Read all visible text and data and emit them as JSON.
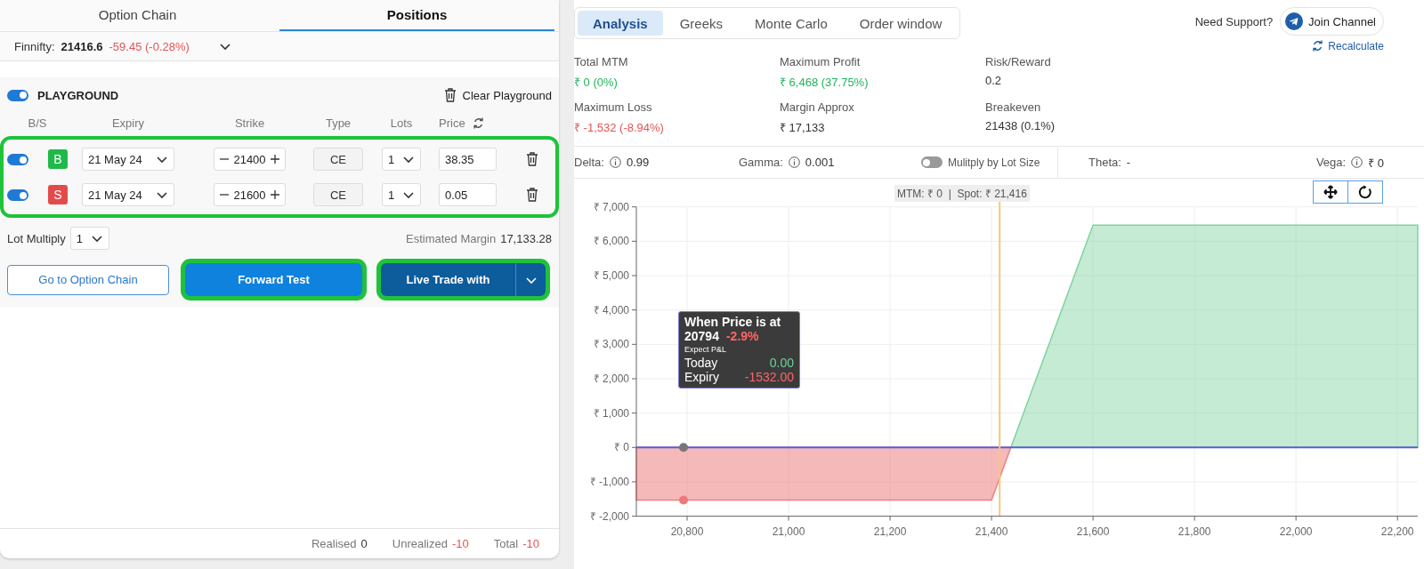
{
  "left_panel": {
    "tabs": [
      {
        "label": "Option Chain",
        "selected": false
      },
      {
        "label": "Positions",
        "selected": true
      }
    ],
    "index": {
      "name": "Finnifty:",
      "price": "21416.6",
      "change": "-59.45 (-0.28%)",
      "color": "#e25555"
    },
    "playground": {
      "on": true,
      "label": "PLAYGROUND",
      "clear_button": "Clear Playground"
    },
    "leg_columns": [
      "B/S",
      "Expiry",
      "Strike",
      "Type",
      "Lots",
      "Price"
    ],
    "legs_highlighted": true,
    "legs": [
      {
        "enabled": true,
        "side": "B",
        "kind": "buy",
        "expiry": "21 May 24",
        "strike": "21400",
        "type": "CE",
        "lots": "1",
        "price": "38.35"
      },
      {
        "enabled": true,
        "side": "S",
        "kind": "sell",
        "expiry": "21 May 24",
        "strike": "21600",
        "type": "CE",
        "lots": "1",
        "price": "0.05"
      }
    ],
    "lot_multiply": {
      "label": "Lot Multiply",
      "value": "1"
    },
    "estimated_margin": {
      "label": "Estimated Margin",
      "value": "17,133.28"
    },
    "buttons": [
      {
        "label": "Go to Option Chain",
        "kind": "outline",
        "highlighted": false
      },
      {
        "label": "Forward Test",
        "kind": "primary",
        "highlighted": true
      },
      {
        "label": "Live Trade with",
        "kind": "split",
        "highlighted": true
      }
    ],
    "footer": [
      {
        "label": "Realised",
        "value": "0",
        "color": "#333333"
      },
      {
        "label": "Unrealized",
        "value": "-10",
        "color": "#e25555"
      },
      {
        "label": "Total",
        "value": "-10",
        "color": "#e25555"
      }
    ]
  },
  "right_panel": {
    "tabs": [
      {
        "label": "Analysis",
        "selected": true
      },
      {
        "label": "Greeks",
        "selected": false
      },
      {
        "label": "Monte Carlo",
        "selected": false
      },
      {
        "label": "Order window",
        "selected": false
      }
    ],
    "support": {
      "label": "Need Support?",
      "button": "Join Channel"
    },
    "recalculate": "Recalculate",
    "stats": [
      {
        "label": "Total MTM",
        "value": "₹ 0 (0%)",
        "color": "#22b35e"
      },
      {
        "label": "Maximum Profit",
        "value": "₹ 6,468 (37.75%)",
        "color": "#22b35e"
      },
      {
        "label": "Risk/Reward",
        "value": "0.2",
        "color": "#333333"
      },
      {
        "label": "Maximum Loss",
        "value": "₹ -1,532 (-8.94%)",
        "color": "#e25555"
      },
      {
        "label": "Margin Approx",
        "value": "₹ 17,133",
        "color": "#333333"
      },
      {
        "label": "Breakeven",
        "value": "21438 (0.1%)",
        "color": "#333333"
      }
    ],
    "greeks": [
      {
        "kind": "metric",
        "label": "Delta:",
        "info": true,
        "value": "0.99"
      },
      {
        "kind": "metric",
        "label": "Gamma:",
        "info": true,
        "value": "0.001"
      },
      {
        "kind": "toggle",
        "label": "Mulitply by Lot Size",
        "on": false
      },
      {
        "kind": "metric",
        "label": "Theta:",
        "info": false,
        "value": "-"
      },
      {
        "kind": "metric",
        "label": "Vega:",
        "info": true,
        "value": "₹ 0"
      }
    ],
    "chart": {
      "header": "MTM: ₹ 0  |  Spot: ₹ 21,416",
      "tooltip": {
        "title": "When Price is at",
        "price": "20794",
        "change": "-2.9%",
        "subtitle": "Expect P&L",
        "rows": [
          {
            "label": "Today",
            "value": "0.00",
            "color": "#6fd39a"
          },
          {
            "label": "Expiry",
            "value": "-1532.00",
            "color": "#ff6565"
          }
        ]
      },
      "chart_data": {
        "type": "area",
        "x": [
          20700,
          21400,
          21438,
          21600,
          22240
        ],
        "series": [
          {
            "color": "#ee8080",
            "values": [
              -1532,
              -1532,
              0,
              null,
              null
            ]
          },
          {
            "color": "#7fd3a0",
            "values": [
              null,
              null,
              0,
              6468,
              6468
            ]
          }
        ],
        "xlim": [
          20700,
          22240
        ],
        "ylim": [
          -2000,
          7000
        ],
        "grid": true,
        "ref_lines": [
          {
            "axis": "y",
            "value": 0,
            "color": "#5a5fd6"
          },
          {
            "axis": "x",
            "value": 21416,
            "color": "#f5c77e"
          }
        ],
        "xticks": [
          {
            "value": 20800,
            "label": "20,800"
          },
          {
            "value": 21000,
            "label": "21,000"
          },
          {
            "value": 21200,
            "label": "21,200"
          },
          {
            "value": 21400,
            "label": "21,400"
          },
          {
            "value": 21600,
            "label": "21,600"
          },
          {
            "value": 21800,
            "label": "21,800"
          },
          {
            "value": 22000,
            "label": "22,000"
          },
          {
            "value": 22200,
            "label": "22,200"
          }
        ],
        "yticks": [
          {
            "value": 7000,
            "label": "₹ 7,000"
          },
          {
            "value": 6000,
            "label": "₹ 6,000"
          },
          {
            "value": 5000,
            "label": "₹ 5,000"
          },
          {
            "value": 4000,
            "label": "₹ 4,000"
          },
          {
            "value": 3000,
            "label": "₹ 3,000"
          },
          {
            "value": 2000,
            "label": "₹ 2,000"
          },
          {
            "value": 1000,
            "label": "₹ 1,000"
          },
          {
            "value": 0,
            "label": "₹ 0"
          },
          {
            "value": -1000,
            "label": "₹ -1,000"
          },
          {
            "value": -2000,
            "label": "₹ -2,000"
          }
        ]
      }
    }
  }
}
